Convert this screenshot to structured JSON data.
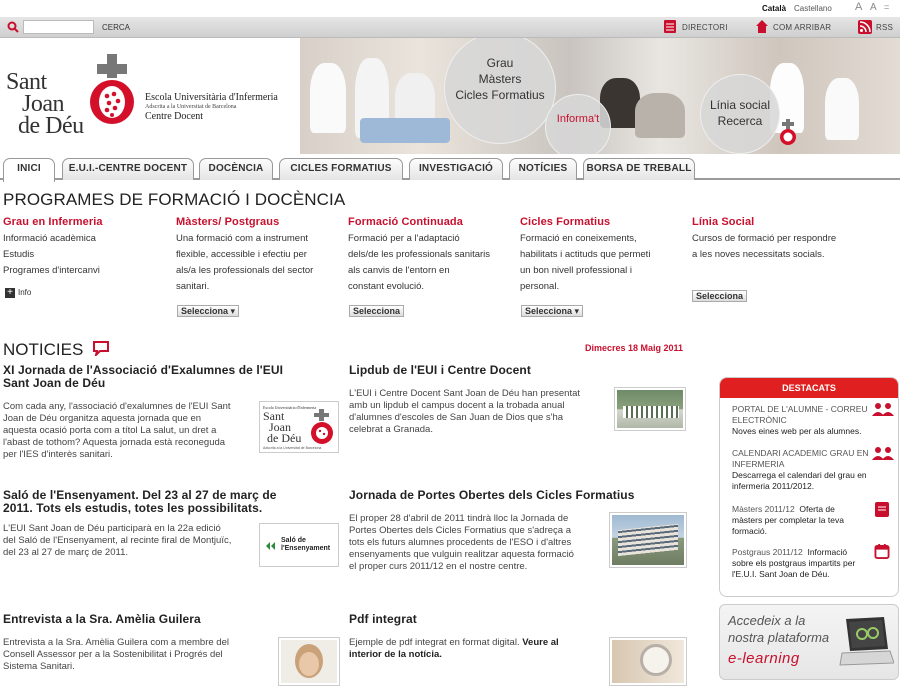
{
  "lang": {
    "catala": "Català",
    "castellano": "Castellano",
    "a_large": "A",
    "a_small": "A",
    "eq": "="
  },
  "search": {
    "placeholder": "",
    "button": "CERCA"
  },
  "toplinks": {
    "directori": "DIRECTORI",
    "com_arribar": "COM ARRIBAR",
    "rss": "RSS"
  },
  "logo": {
    "line1": "Sant",
    "line2": "Joan",
    "line3": "de Déu",
    "school": "Escola Universitària d'Infermeria",
    "adscrita": "Adscrita a la Universitat de Barcelona",
    "centre": "Centre Docent"
  },
  "banner": {
    "circle1": [
      "Grau",
      "Màsters",
      "Cicles Formatius"
    ],
    "informat": "Informa't",
    "circle2": [
      "Línia social",
      "Recerca"
    ]
  },
  "nav": {
    "tabs": [
      "INICI",
      "E.U.I.-CENTRE DOCENT",
      "DOCÈNCIA",
      "CICLES FORMATIUS",
      "INVESTIGACIÓ",
      "NOTÍCIES",
      "BORSA DE TREBALL"
    ]
  },
  "programes": {
    "heading": "PROGRAMES DE FORMACIÓ I DOCÈNCIA",
    "grau": {
      "title": "Grau en Infermeria",
      "links": [
        "Informació acadèmica",
        "Estudis",
        "Programes d'intercanvi"
      ],
      "info": "Info"
    },
    "masters": {
      "title": "Màsters/ Postgraus",
      "lines": [
        "Una formació com a instrument",
        "flexible, accessible i efectiu per",
        "als/a les professionals del sector",
        "sanitari."
      ],
      "select": "Selecciona ▾"
    },
    "formacio": {
      "title": "Formació Continuada",
      "lines": [
        "Formació per a l'adaptació",
        "dels/de les professionals sanitaris",
        "als canvis de l'entorn en",
        "constant evolució."
      ],
      "select": "Selecciona"
    },
    "cicles": {
      "title": "Cicles Formatius",
      "lines": [
        "Formació en coneixements,",
        "habilitats i actituds que permeti",
        "un bon nivell professional i",
        "personal."
      ],
      "select": "Selecciona ▾"
    },
    "linia": {
      "title": "Línia Social",
      "lines": [
        "Cursos de formació per respondre",
        "a les noves necessitats socials."
      ],
      "select": "Selecciona"
    }
  },
  "news": {
    "heading": "NOTICIES",
    "date": "Dimecres 18 Maig 2011",
    "items": [
      {
        "title": [
          "XI Jornada de l'Associació d'Exalumnes de l'EUI",
          "Sant Joan de Déu"
        ],
        "body": [
          "Com cada any, l'associació d'exalumnes de l'EUI Sant",
          "Joan de Déu organitza aquesta jornada que en",
          "aquesta ocasió porta com a títol La salut, un dret a",
          "l'abast de tothom? Aquesta jornada està reconeguda",
          "per l'IES d'interès sanitari."
        ]
      },
      {
        "title": [
          "Lipdub de l'EUI i Centre Docent"
        ],
        "body": [
          "L'EUI i Centre Docent Sant Joan de Déu han presentat",
          "amb un lipdub el campus docent a la trobada anual",
          "d'alumnes d'escoles de San Juan de Dios que s'ha",
          "celebrat a Granada."
        ]
      },
      {
        "title": [
          "Saló de l'Ensenyament. Del 23 al 27 de març de",
          "2011. Tots els estudis, totes les possibilitats."
        ],
        "body": [
          "L'EUI Sant Joan de Déu participarà en la 22a edició",
          "del Saló de l'Ensenyament, al recinte firal de Montjuïc,",
          "del 23 al 27 de març de 2011."
        ],
        "thumb_text": [
          "Saló de",
          "l'Ensenyament"
        ]
      },
      {
        "title": [
          "Jornada de Portes Obertes dels Cicles Formatius"
        ],
        "body": [
          "El proper 28 d'abril de 2011 tindrà lloc la Jornada de",
          "Portes Obertes dels Cicles Formatius que s'adreça a",
          "tots els futurs alumnes procedents de l'ESO i d'altres",
          "ensenyaments que vulguin realitzar aquesta formació",
          "el proper curs 2011/12 en el nostre centre."
        ]
      },
      {
        "title": [
          "Entrevista a la Sra. Amèlia Guilera"
        ],
        "body": [
          "Entrevista a la Sra. Amèlia Guilera com a membre del",
          "Consell Assessor per a la Sostenibilitat i Progrés del",
          "Sistema Sanitari."
        ]
      },
      {
        "title": [
          "Pdf integrat"
        ],
        "body": [
          "Ejemple de pdf integrat en format digital. ",
          "Veure al",
          "interior de la notícia."
        ]
      }
    ],
    "thumb1": {
      "line1": "Escola Universitària d'Infermeria",
      "line2": "Sant",
      "line3": "Joan",
      "line4": "de Déu",
      "line5": "Adscrita a la Universitat de Barcelona"
    }
  },
  "destacats": {
    "heading": "DESTACATS",
    "items": [
      {
        "title": "PORTAL DE L'ALUMNE - CORREU ELECTRÒNIC",
        "sub": "Noves eines web per als alumnes."
      },
      {
        "title": "CALENDARI ACADEMIC GRAU EN INFERMERIA",
        "sub": "Descarrega el calendari del grau en infermeria 2011/2012."
      },
      {
        "title": "Màsters 2011/12",
        "sub": "Oferta de màsters per completar la teva formació."
      },
      {
        "title": "Postgraus 2011/12",
        "sub": "Informació sobre els postgraus impartits per l'E.U.I. Sant Joan de Déu."
      }
    ]
  },
  "elearning": {
    "line1": "Accedeix a la",
    "line2": "nostra plataforma",
    "line3": "e-learning"
  },
  "colors": {
    "accent": "#c8102e",
    "nav_border": "#9a9a9a"
  }
}
